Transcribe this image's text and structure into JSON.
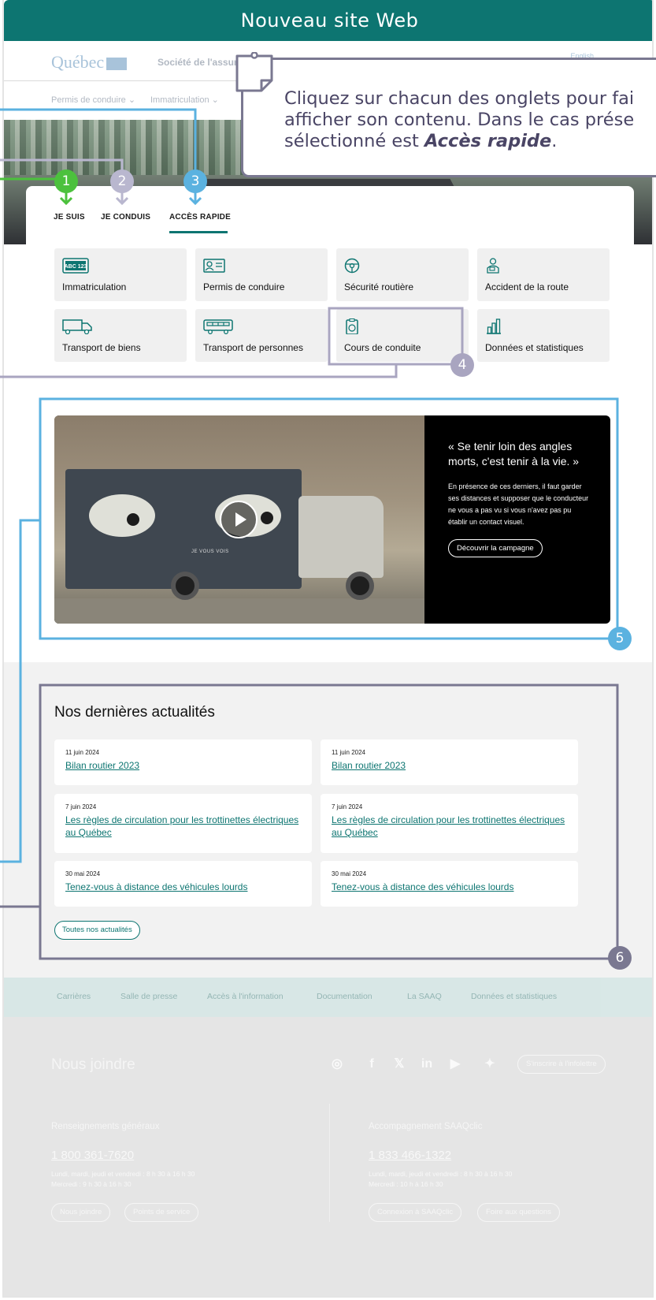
{
  "banner": {
    "title": "Nouveau site Web"
  },
  "header": {
    "logo": "Québec",
    "org": "Société de l'assurance automobile",
    "lang": "English",
    "menu": [
      "Permis de conduire",
      "Immatriculation"
    ]
  },
  "callout": {
    "line1": "Cliquez sur chacun des onglets pour fai",
    "line2": "afficher son contenu. Dans le cas prése",
    "line3_prefix": "sélectionné est ",
    "line3_bold": "Accès rapide",
    "line3_suffix": "."
  },
  "tabs": [
    {
      "label": "JE SUIS",
      "badge": "1"
    },
    {
      "label": "JE CONDUIS",
      "badge": "2"
    },
    {
      "label": "ACCÈS RAPIDE",
      "badge": "3"
    }
  ],
  "tiles": [
    {
      "label": "Immatriculation",
      "icon": "license-plate-icon"
    },
    {
      "label": "Permis de conduire",
      "icon": "id-card-icon"
    },
    {
      "label": "Sécurité routière",
      "icon": "steering-wheel-icon"
    },
    {
      "label": "Accident de la route",
      "icon": "injured-person-icon"
    },
    {
      "label": "Transport de biens",
      "icon": "truck-icon"
    },
    {
      "label": "Transport de personnes",
      "icon": "bus-icon"
    },
    {
      "label": "Cours de conduite",
      "icon": "clipboard-wheel-icon"
    },
    {
      "label": "Données et statistiques",
      "icon": "bar-chart-icon"
    }
  ],
  "badges": {
    "b4": "4",
    "b5": "5",
    "b6": "6"
  },
  "video": {
    "truck_text": "JE VOUS VOIS",
    "quote": "« Se tenir loin des angles morts, c'est tenir à la vie. »",
    "body": "En présence de ces derniers, il faut garder ses distances et supposer que le conducteur ne vous a pas vu si vous n'avez pas pu établir un contact visuel.",
    "button": "Découvrir la campagne"
  },
  "news": {
    "title": "Nos dernières actualités",
    "items": [
      {
        "date": "11 juin 2024",
        "title": "Bilan routier 2023"
      },
      {
        "date": "11 juin 2024",
        "title": "Bilan routier 2023"
      },
      {
        "date": "7 juin 2024",
        "title": "Les règles de circulation pour les trottinettes électriques au Québec"
      },
      {
        "date": "7 juin 2024",
        "title": "Les règles de circulation pour les trottinettes électriques au Québec"
      },
      {
        "date": "30 mai 2024",
        "title": "Tenez-vous à distance des véhicules lourds"
      },
      {
        "date": "30 mai 2024",
        "title": "Tenez-vous à distance des véhicules lourds"
      }
    ],
    "all_button": "Toutes nos actualités"
  },
  "footer": {
    "links": [
      "Carrières",
      "Salle de presse",
      "Accès à l'information",
      "Documentation",
      "La SAAQ",
      "Données et statistiques"
    ],
    "title": "Nous joindre",
    "newsletter": "S'inscrire à l'infolettre",
    "left": {
      "heading": "Renseignements généraux",
      "phone": "1 800 361-7620",
      "hours1": "Lundi, mardi, jeudi et vendredi : 8 h 30 à 16 h 30",
      "hours2": "Mercredi : 9 h 30 à 16 h 30",
      "btn1": "Nous joindre",
      "btn2": "Points de service"
    },
    "right": {
      "heading": "Accompagnement SAAQclic",
      "phone": "1 833 466-1322",
      "hours1": "Lundi, mardi, jeudi et vendredi : 8 h 30 à 16 h 30",
      "hours2": "Mercredi : 10 h à 16 h 30",
      "btn1": "Connexion à SAAQclic",
      "btn2": "Foire aux questions"
    }
  },
  "colors": {
    "teal": "#0d7571",
    "green": "#4cc13d",
    "lavender": "#b9b7cf",
    "blue": "#5bb2e0",
    "slate": "#7a7891"
  }
}
